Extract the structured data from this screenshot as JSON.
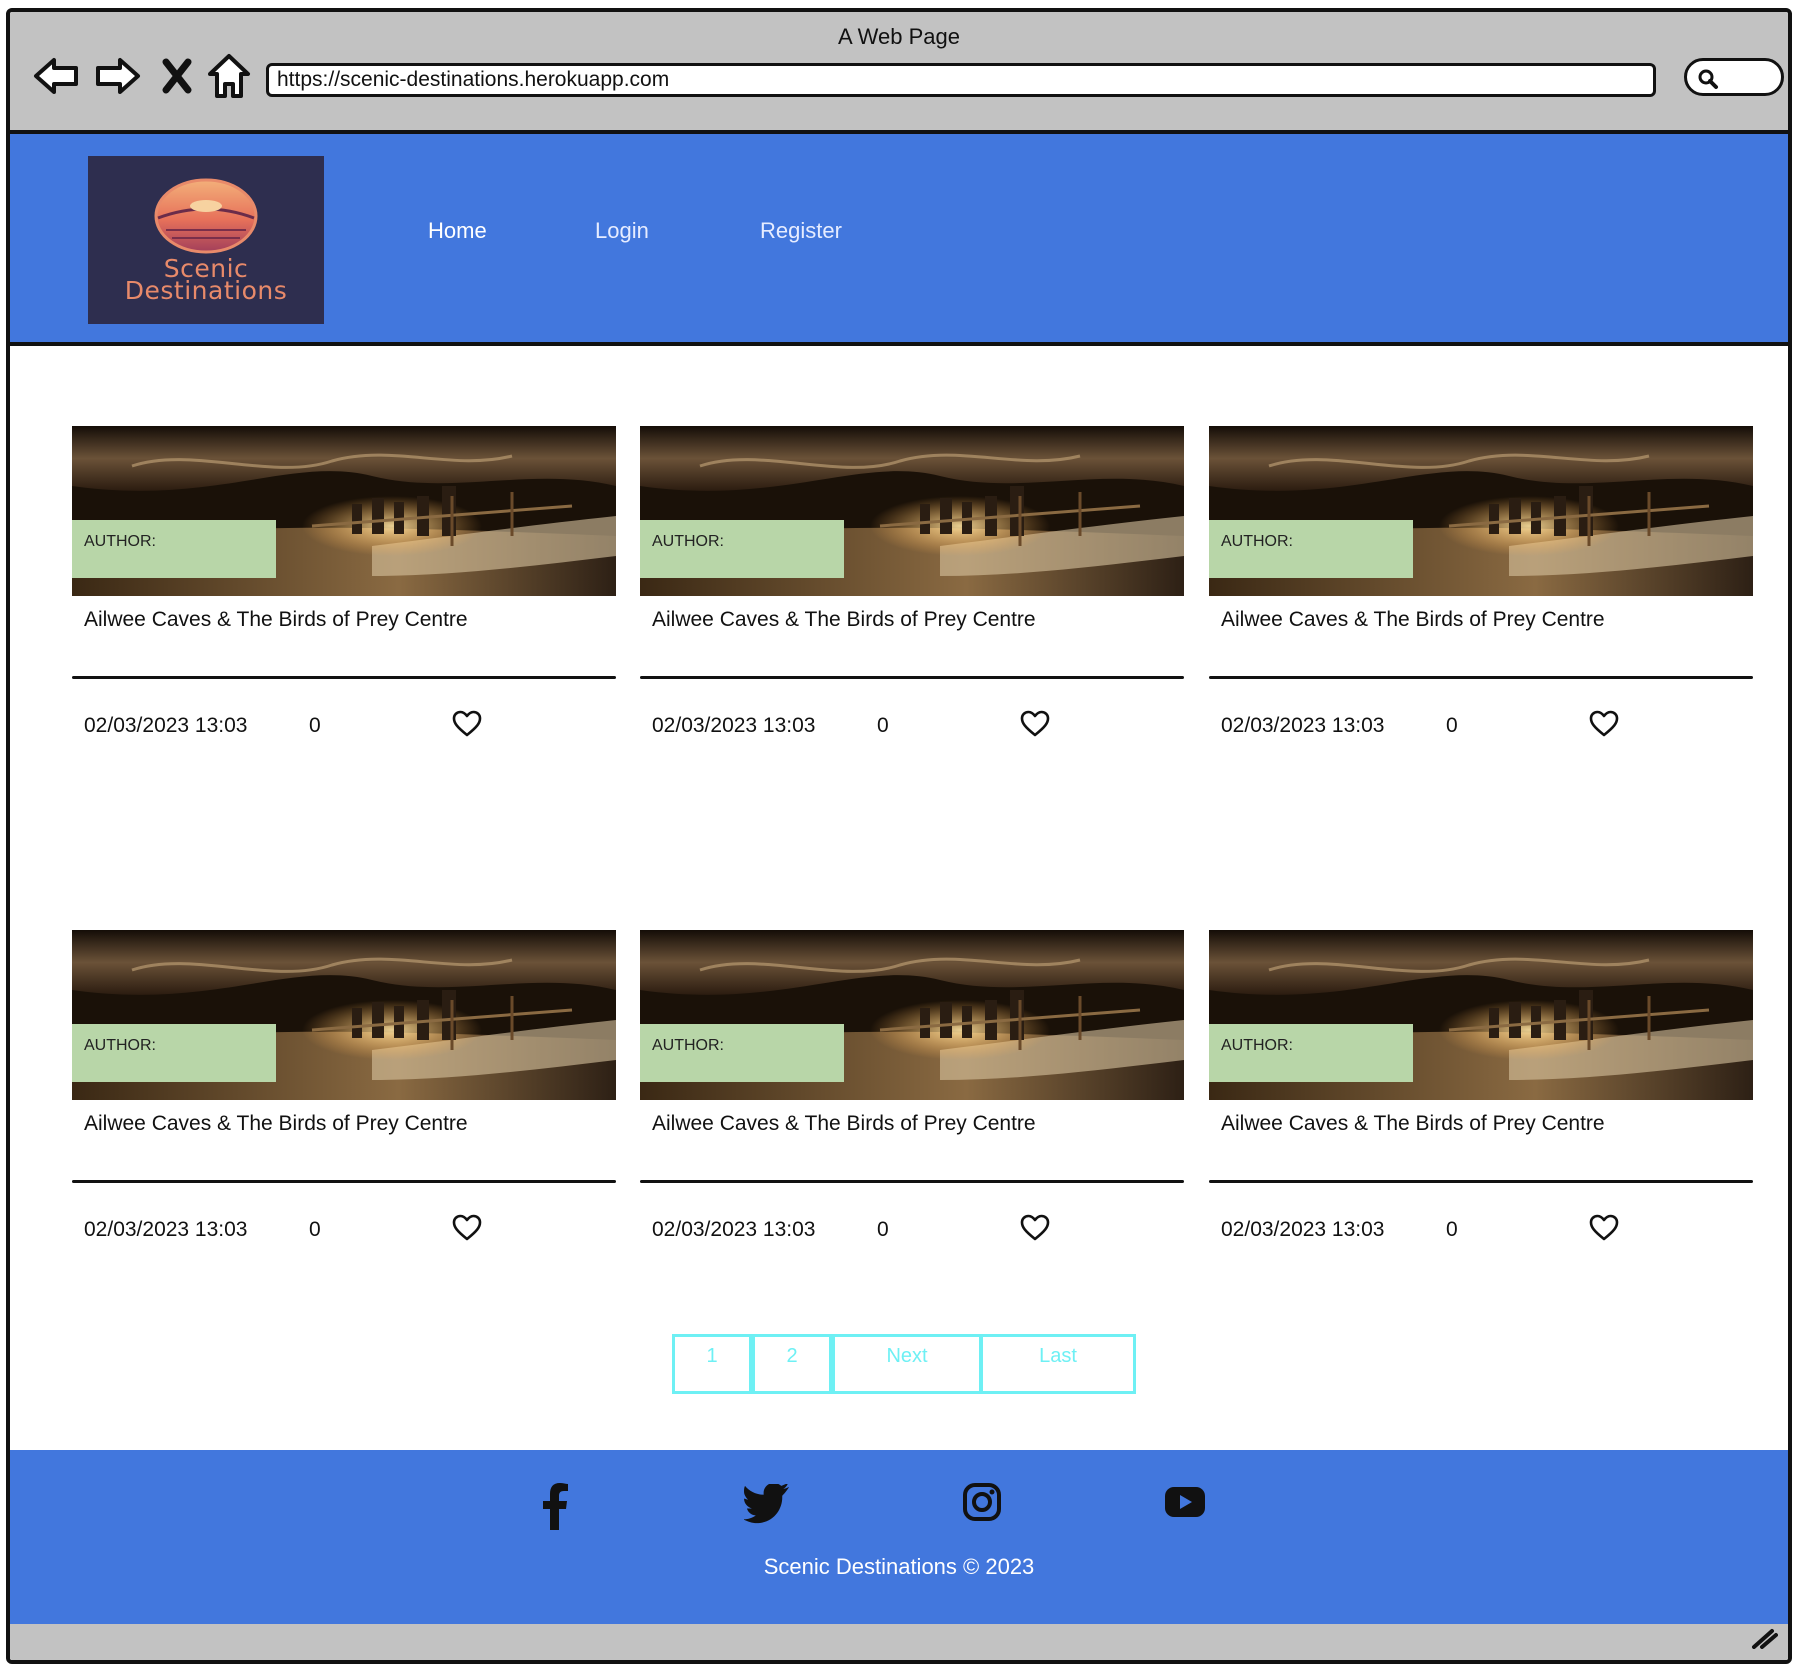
{
  "browser": {
    "title": "A Web Page",
    "url": "https://scenic-destinations.herokuapp.com"
  },
  "logo": {
    "line1": "Scenic",
    "line2": "Destinations"
  },
  "nav": {
    "items": [
      {
        "label": "Home"
      },
      {
        "label": "Login"
      },
      {
        "label": "Register"
      }
    ]
  },
  "cards": [
    {
      "author_label": "AUTHOR:",
      "title": "Ailwee Caves & The Birds of Prey Centre",
      "date": "02/03/2023 13:03",
      "likes": "0"
    },
    {
      "author_label": "AUTHOR:",
      "title": "Ailwee Caves & The Birds of Prey Centre",
      "date": "02/03/2023 13:03",
      "likes": "0"
    },
    {
      "author_label": "AUTHOR:",
      "title": "Ailwee Caves & The Birds of Prey Centre",
      "date": "02/03/2023 13:03",
      "likes": "0"
    },
    {
      "author_label": "AUTHOR:",
      "title": "Ailwee Caves & The Birds of Prey Centre",
      "date": "02/03/2023 13:03",
      "likes": "0"
    },
    {
      "author_label": "AUTHOR:",
      "title": "Ailwee Caves & The Birds of Prey Centre",
      "date": "02/03/2023 13:03",
      "likes": "0"
    },
    {
      "author_label": "AUTHOR:",
      "title": "Ailwee Caves & The Birds of Prey Centre",
      "date": "02/03/2023 13:03",
      "likes": "0"
    }
  ],
  "pagination": {
    "items": [
      {
        "label": "1"
      },
      {
        "label": "2"
      },
      {
        "label": "Next"
      },
      {
        "label": "Last"
      }
    ]
  },
  "footer": {
    "social": [
      "facebook-icon",
      "twitter-icon",
      "instagram-icon",
      "youtube-icon"
    ],
    "copyright": "Scenic Destinations © 2023"
  },
  "colors": {
    "header_bg": "#4277dd",
    "author_bg": "#b8d6a8",
    "pagination": "#6ef0f4",
    "chrome": "#c2c2c2"
  }
}
